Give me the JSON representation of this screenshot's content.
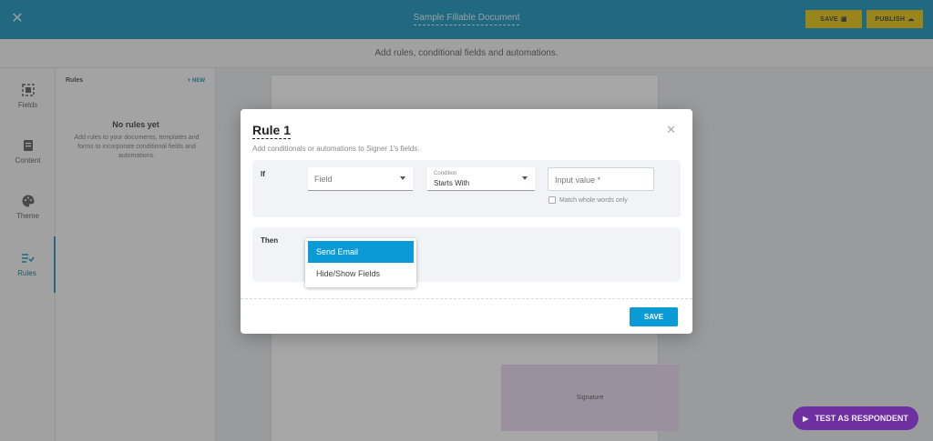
{
  "header": {
    "doc_title": "Sample Fillable Document",
    "save_label": "SAVE",
    "publish_label": "PUBLISH"
  },
  "subheader": "Add rules, conditional fields and automations.",
  "nav": [
    {
      "label": "Fields",
      "icon": "fields-icon"
    },
    {
      "label": "Content",
      "icon": "content-icon"
    },
    {
      "label": "Theme",
      "icon": "palette-icon"
    },
    {
      "label": "Rules",
      "icon": "rules-icon"
    }
  ],
  "panel": {
    "title": "Rules",
    "new_label": "+ NEW",
    "empty_title": "No rules yet",
    "empty_desc": "Add rules to your documents, templates and forms to incorporate conditional fields and automations."
  },
  "canvas": {
    "signature_label": "Signature"
  },
  "test_button": "TEST AS RESPONDENT",
  "modal": {
    "title": "Rule 1",
    "subtitle": "Add conditionals or automations to Signer 1's fields.",
    "if_label": "If",
    "field_placeholder": "Field",
    "condition_label": "Condition",
    "condition_value": "Starts With",
    "input_placeholder": "Input value *",
    "match_whole_label": "Match whole words only",
    "then_label": "Then",
    "dropdown_options": [
      "Send Email",
      "Hide/Show Fields"
    ],
    "save_label": "SAVE"
  },
  "colors": {
    "header_bg": "#0a8fb8",
    "accent": "#0a9bd6",
    "header_button": "#e3c200",
    "test_button": "#6e2fa0"
  }
}
